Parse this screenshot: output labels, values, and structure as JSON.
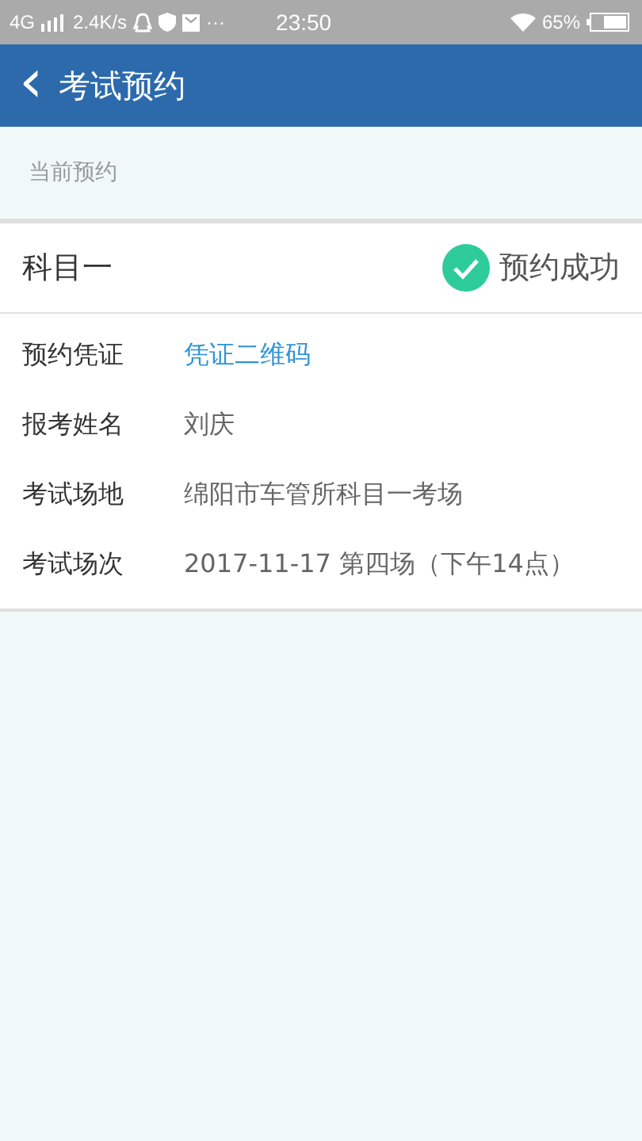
{
  "status_bar": {
    "network": "4G",
    "speed": "2.4K/s",
    "more": "···",
    "time": "23:50",
    "battery": "65%"
  },
  "header": {
    "back": "‹",
    "title": "考试预约"
  },
  "section_label": "当前预约",
  "booking": {
    "subject": "科目一",
    "status": "预约成功",
    "success": true,
    "rows": [
      {
        "label": "预约凭证",
        "value": "凭证二维码",
        "kind": "link"
      },
      {
        "label": "报考姓名",
        "value": "刘庆",
        "kind": "text"
      },
      {
        "label": "考试场地",
        "value": "绵阳市车管所科目一考场",
        "kind": "text"
      },
      {
        "label": "考试场次",
        "value": "2017-11-17 第四场（下午14点）",
        "kind": "text"
      }
    ]
  }
}
